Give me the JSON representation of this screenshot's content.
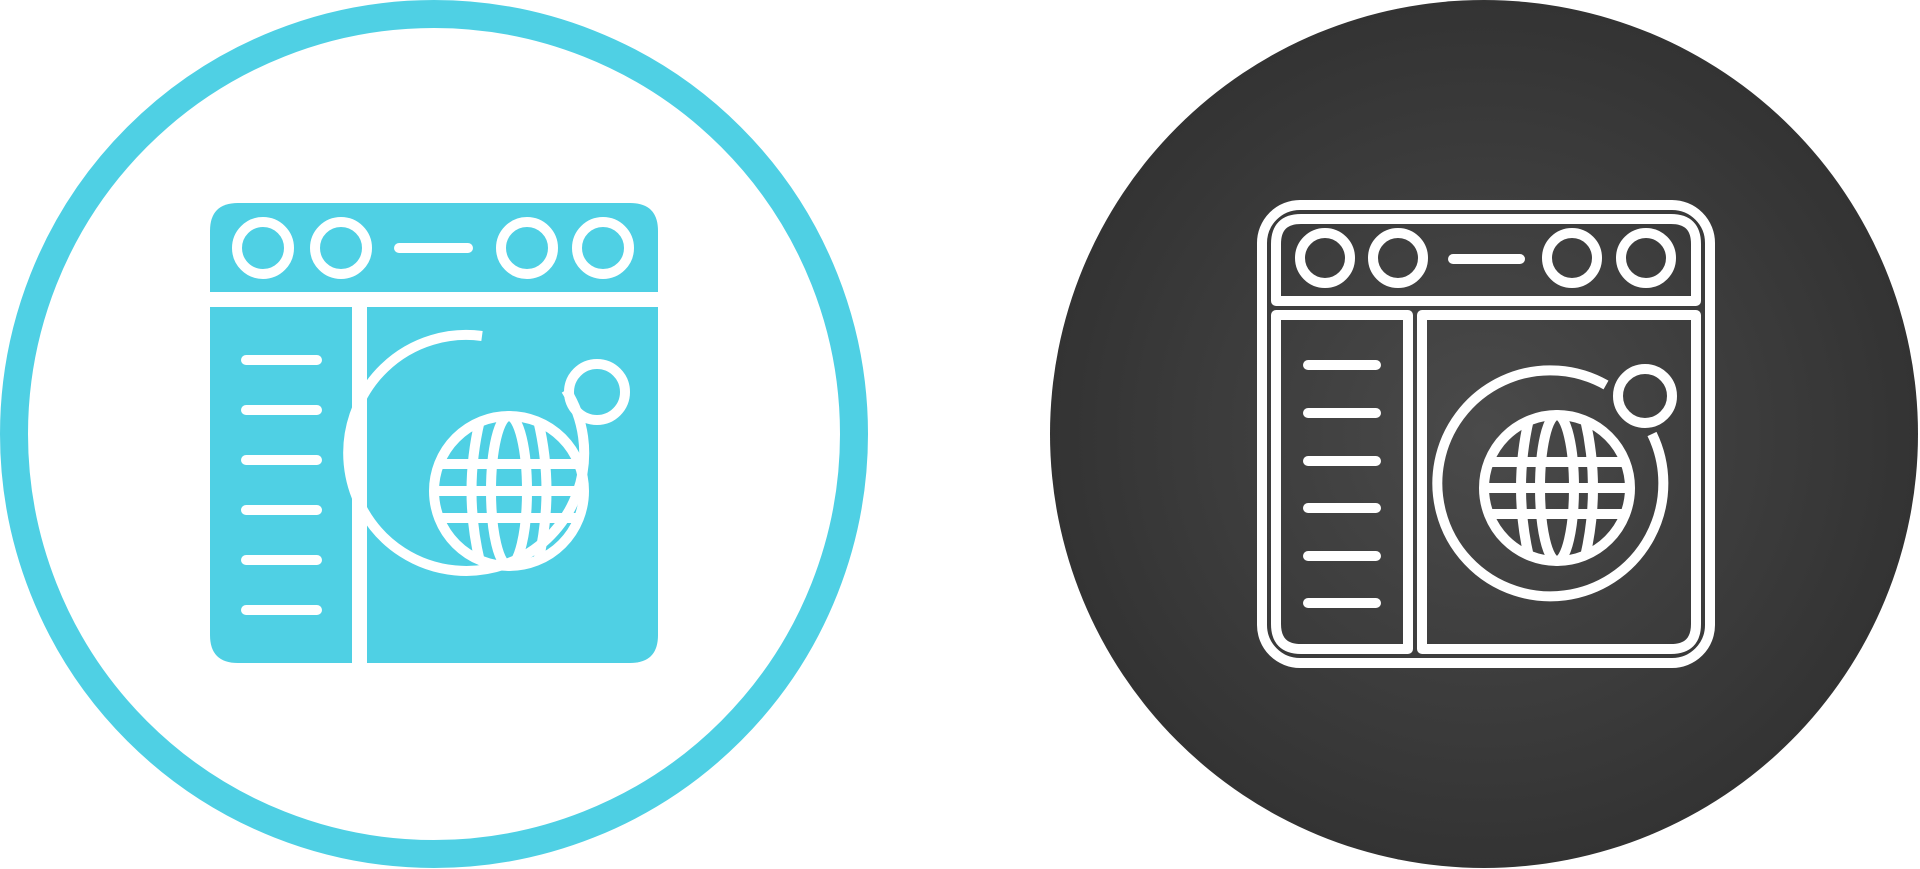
{
  "colors": {
    "accent": "#4fd0e4",
    "background": "#ffffff",
    "dark_circle_edge": "#333333",
    "dark_circle_center": "#4a4a4a",
    "stroke": "#ffffff"
  },
  "icons": [
    {
      "name": "browser-globe-glyph-icon",
      "style": "glyph",
      "list_lines": 6,
      "toolbar_dots": 4
    },
    {
      "name": "browser-globe-outline-icon",
      "style": "outline",
      "list_lines": 6,
      "toolbar_dots": 4
    }
  ]
}
